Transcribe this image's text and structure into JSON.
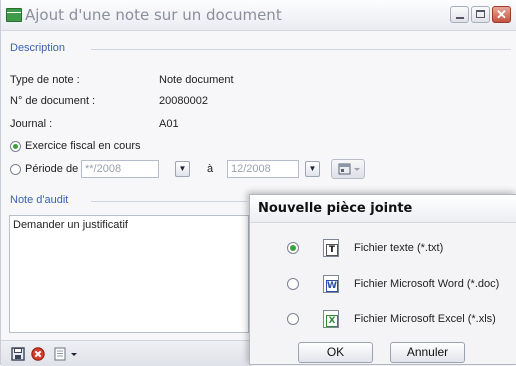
{
  "window": {
    "title": "Ajout d'une note sur un document"
  },
  "description": {
    "header": "Description",
    "type_label": "Type de note :",
    "type_value": "Note document",
    "doc_label": "N° de document :",
    "doc_value": "20080002",
    "journal_label": "Journal :",
    "journal_value": "A01",
    "opt_exercice": "Exercice fiscal en cours",
    "opt_periode": "Période de",
    "periode_from": "**/2008",
    "periode_sep": "à",
    "periode_to": "12/2008"
  },
  "audit": {
    "header": "Note d'audit",
    "text": "Demander un justificatif"
  },
  "dialog": {
    "title": "Nouvelle pièce jointe",
    "options": [
      {
        "label": "Fichier texte (*.txt)",
        "icon": "text-file-icon",
        "glyph": "T",
        "selected": true
      },
      {
        "label": "Fichier Microsoft Word (*.doc)",
        "icon": "word-file-icon",
        "glyph": "W",
        "selected": false
      },
      {
        "label": "Fichier Microsoft Excel (*.xls)",
        "icon": "excel-file-icon",
        "glyph": "X",
        "selected": false
      }
    ],
    "ok": "OK",
    "cancel": "Annuler"
  },
  "colors": {
    "accent": "#3c62b0",
    "radio_on": "#3aa23a",
    "excel": "#2e8b3a",
    "word": "#2b4ea8"
  }
}
